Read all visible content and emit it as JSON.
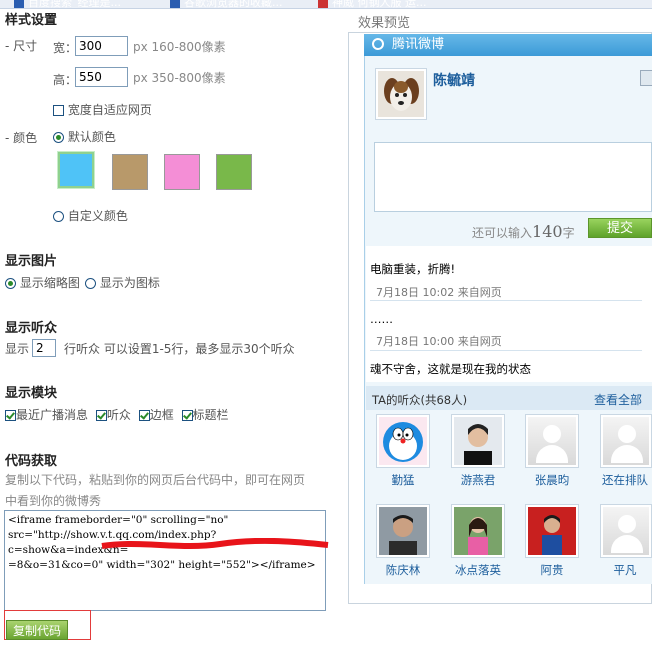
{
  "bookmarks": [
    "百度搜索_经理是...",
    "谷歌浏览器的收藏...",
    "神威 何钢人服 运..."
  ],
  "left": {
    "style_title": "样式设置",
    "size_label": "- 尺寸",
    "width_label": "宽：",
    "width_value": "300",
    "width_hint": "px 160-800像素",
    "height_label": "高：",
    "height_value": "550",
    "height_hint": "px 350-800像素",
    "autofit_label": "宽度自适应网页",
    "color_label": "- 颜色",
    "default_color_label": "默认颜色",
    "custom_color_label": "自定义颜色",
    "swatch_colors": [
      "#4fc3f7",
      "#b8996a",
      "#f48ed6",
      "#79b84a"
    ],
    "image_title": "显示图片",
    "thumb_label": "显示缩略图",
    "icon_label": "显示为图标",
    "audience_title": "显示听众",
    "show_prefix": "显示",
    "rows_value": "2",
    "rows_hint": "行听众 可以设置1-5行，最多显示30个听众",
    "module_title": "显示模块",
    "modules": [
      "最近广播消息",
      "听众",
      "边框",
      "标题栏"
    ],
    "code_title": "代码获取",
    "code_hint_1": "复制以下代码，粘贴到你的网页后台代码中，即可在网页",
    "code_hint_2": "中看到你的微博秀",
    "code_text": "<iframe frameborder=\"0\" scrolling=\"no\" src=\"http://show.v.t.qq.com/index.php?c=show&a=index&n=                              =8&o=31&co=0\" width=\"302\" height=\"552\"></iframe>",
    "copy_button": "复制代码"
  },
  "right": {
    "preview_title": "效果预览",
    "widget_title": "腾讯微博",
    "user_name": "陈毓靖",
    "counter_prefix": "还可以输入",
    "counter_number": "140",
    "counter_suffix": "字",
    "submit_label": "提交",
    "feed": [
      {
        "text": "电脑重装，折腾!",
        "meta": "7月18日  10:02  来自网页"
      },
      {
        "text": "……",
        "meta": "7月18日  10:00  来自网页"
      },
      {
        "text": "魂不守舍，这就是现在我的状态",
        "meta": ""
      }
    ],
    "audience_header": "TA的听众(共68人)",
    "view_all": "查看全部",
    "audience": [
      "勤猛",
      "游燕君",
      "张晨昀",
      "还在排队",
      "陈庆林",
      "冰点落英",
      "阿贵",
      "平凡"
    ]
  }
}
